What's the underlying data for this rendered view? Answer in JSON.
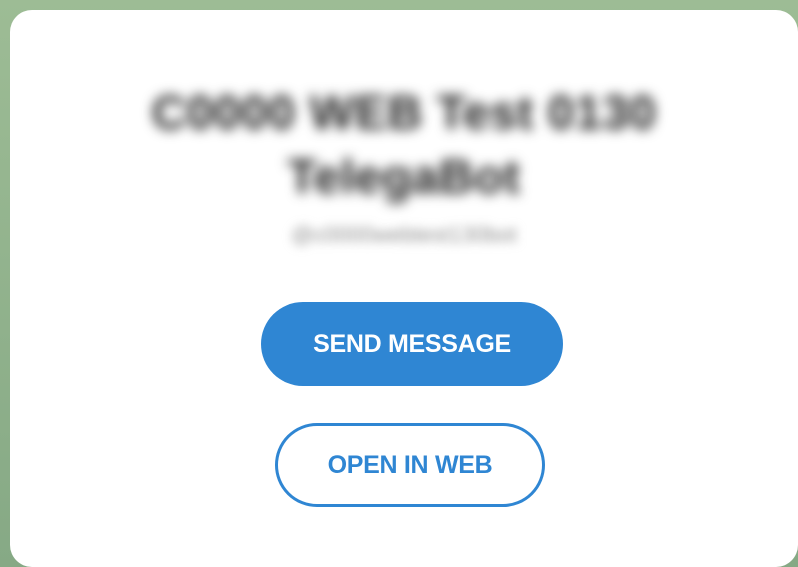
{
  "dialog": {
    "title_line_1": "C0000 WEB Test 0130",
    "title_line_2": "TelegaBot",
    "subtitle": "@c0000webtest130bot",
    "send_message_label": "SEND MESSAGE",
    "open_in_web_label": "OPEN IN WEB"
  },
  "colors": {
    "accent": "#2f86d3",
    "card_background": "#ffffff",
    "backdrop": "#8fb08a"
  }
}
